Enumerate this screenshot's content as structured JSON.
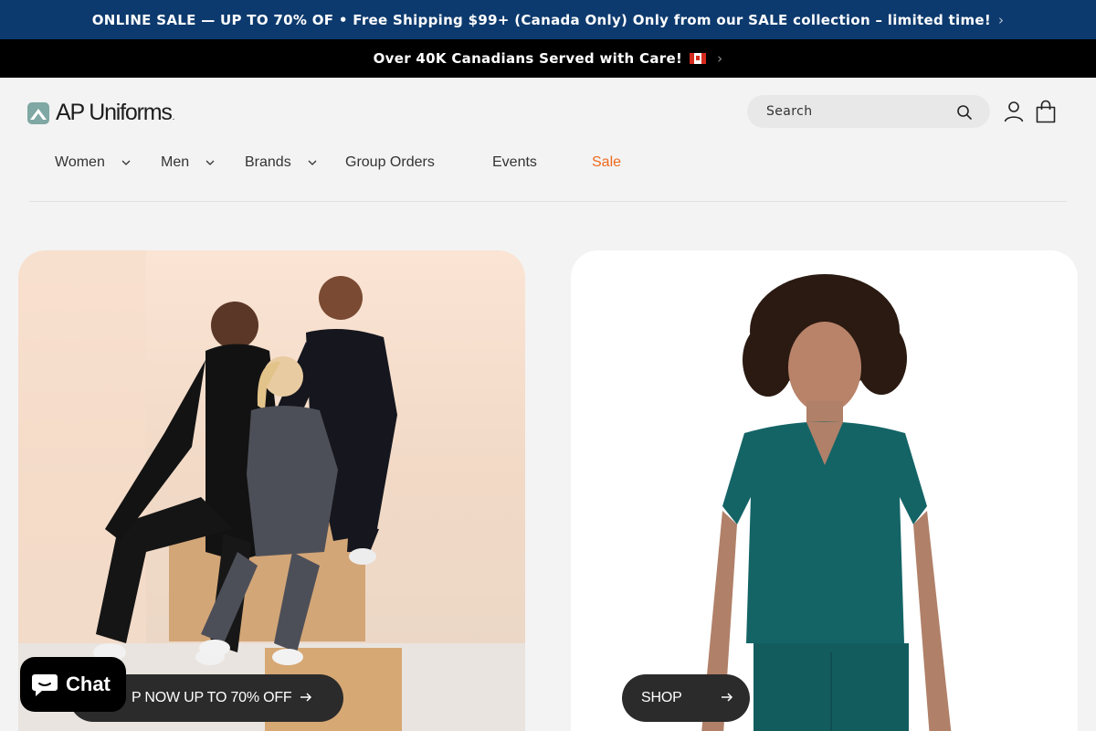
{
  "announcements": {
    "primary": "ONLINE SALE — UP TO 70% OF • Free Shipping $99+ (Canada Only) Only from our SALE collection – limited time!",
    "secondary": "Over 40K Canadians Served with Care!"
  },
  "header": {
    "logo_text": "AP Uniforms",
    "logo_suffix": ".",
    "search_placeholder": "Search",
    "icons": [
      "search-icon",
      "account-icon",
      "cart-icon"
    ]
  },
  "nav": {
    "items": [
      {
        "label": "Women",
        "dropdown": true
      },
      {
        "label": "Men",
        "dropdown": true
      },
      {
        "label": "Brands",
        "dropdown": true
      },
      {
        "label": "Group Orders",
        "dropdown": false
      },
      {
        "label": "Events",
        "dropdown": false
      },
      {
        "label": "Sale",
        "dropdown": false,
        "color": "#ef6a1e"
      }
    ]
  },
  "hero": {
    "left_button": "P NOW UP TO 70% OFF",
    "right_button": "SHOP"
  },
  "chat_widget": {
    "label": "Chat"
  },
  "colors": {
    "announce_bg": "#0d3a6e",
    "announce2_bg": "#000000",
    "accent_sale": "#ef6a1e",
    "button_bg": "#2b2b2b",
    "scrub_teal": "#146466"
  }
}
